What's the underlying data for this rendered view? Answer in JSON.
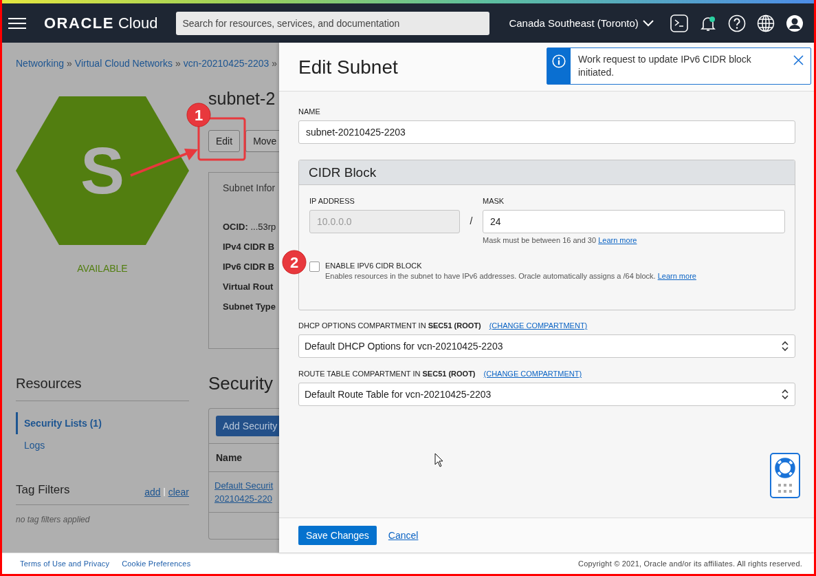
{
  "header": {
    "brand": "ORACLE",
    "brand_suffix": "Cloud",
    "search_placeholder": "Search for resources, services, and documentation",
    "region": "Canada Southeast (Toronto)",
    "unread": true
  },
  "background": {
    "breadcrumbs": [
      "Networking",
      "Virtual Cloud Networks",
      "vcn-20210425-2203"
    ],
    "separator": "»",
    "resource": {
      "title": "subnet-2",
      "icon_letter": "S",
      "status": "AVAILABLE",
      "actions": [
        "Edit",
        "Move"
      ],
      "info_title": "Subnet Infor",
      "info_rows": [
        {
          "label": "OCID:",
          "value": "...53rp"
        },
        {
          "label": "IPv4 CIDR B"
        },
        {
          "label": "IPv6 CIDR B"
        },
        {
          "label": "Virtual Rout"
        },
        {
          "label": "Subnet Type"
        }
      ]
    },
    "resources": {
      "title": "Resources",
      "items": [
        {
          "label": "Security Lists (1)",
          "selected": true
        },
        {
          "label": "Logs",
          "selected": false
        }
      ]
    },
    "tag_filters": {
      "title": "Tag Filters",
      "add": "add",
      "separator": "|",
      "clear": "clear",
      "empty": "no tag filters applied"
    },
    "security_lists": {
      "title": "Security",
      "add_button": "Add Security",
      "columns": [
        "Name"
      ],
      "rows": [
        {
          "name_lines": [
            "Default Securit",
            "20210425-220"
          ]
        }
      ]
    }
  },
  "drawer": {
    "title": "Edit Subnet",
    "name_label": "NAME",
    "name_value": "subnet-20210425-2203",
    "cidr": {
      "title": "CIDR Block",
      "ip_label": "IP ADDRESS",
      "ip_value": "10.0.0.0",
      "ip_disabled": true,
      "slash": "/",
      "mask_label": "MASK",
      "mask_value": "24",
      "mask_help": "Mask must be between 16 and 30",
      "mask_help_link": "Learn more",
      "ipv6": {
        "label": "ENABLE IPV6 CIDR BLOCK",
        "checked": false,
        "help": "Enables resources in the subnet to have IPv6 addresses. Oracle automatically assigns a /64 block.",
        "help_link": "Learn more"
      }
    },
    "selects": [
      {
        "label": "DHCP OPTIONS COMPARTMENT IN **SEC51 (ROOT)**",
        "link": "(CHANGE COMPARTMENT)",
        "value": "Default DHCP Options for vcn-20210425-2203"
      },
      {
        "label": "ROUTE TABLE COMPARTMENT IN **SEC51 (ROOT)**",
        "link": "(CHANGE COMPARTMENT)",
        "value": "Default Route Table for vcn-20210425-2203"
      }
    ],
    "save": "Save Changes",
    "cancel": "Cancel",
    "toast": {
      "message": "Work request to update IPv6 CIDR block initiated."
    }
  },
  "footer": {
    "links": [
      "Terms of Use and Privacy",
      "Cookie Preferences"
    ],
    "copyright": "Copyright © 2021, Oracle and/or its affiliates. All rights reserved."
  },
  "annotations": [
    {
      "kind": "frame"
    },
    {
      "kind": "arrow"
    },
    {
      "kind": "badge",
      "label": "1"
    },
    {
      "kind": "badge",
      "label": "2"
    }
  ]
}
